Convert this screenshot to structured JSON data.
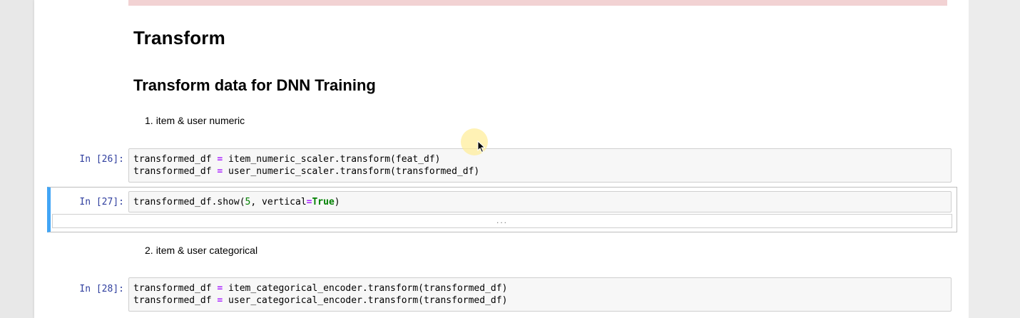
{
  "headings": {
    "h1": "Transform",
    "h2": "Transform data for DNN Training"
  },
  "list_items": [
    {
      "number": "1.",
      "text": "item & user numeric"
    },
    {
      "number": "2.",
      "text": "item & user categorical"
    }
  ],
  "cells": [
    {
      "prompt": "In [26]:",
      "lines": [
        "transformed_df = item_numeric_scaler.transform(feat_df)",
        "transformed_df = user_numeric_scaler.transform(transformed_df)"
      ]
    },
    {
      "prompt": "In [27]:",
      "lines": [
        "transformed_df.show(5, vertical=True)"
      ],
      "collapsed_output": "..."
    },
    {
      "prompt": "In [28]:",
      "lines": [
        "transformed_df = item_categorical_encoder.transform(transformed_df)",
        "transformed_df = user_categorical_encoder.transform(transformed_df)"
      ]
    }
  ],
  "colors": {
    "prompt": "#303f9f",
    "selected_border": "#42a5f5",
    "error_banner": "#f2d2d3",
    "code_background": "#f7f7f7"
  },
  "icons": {
    "cursor": "mouse-pointer-icon"
  }
}
